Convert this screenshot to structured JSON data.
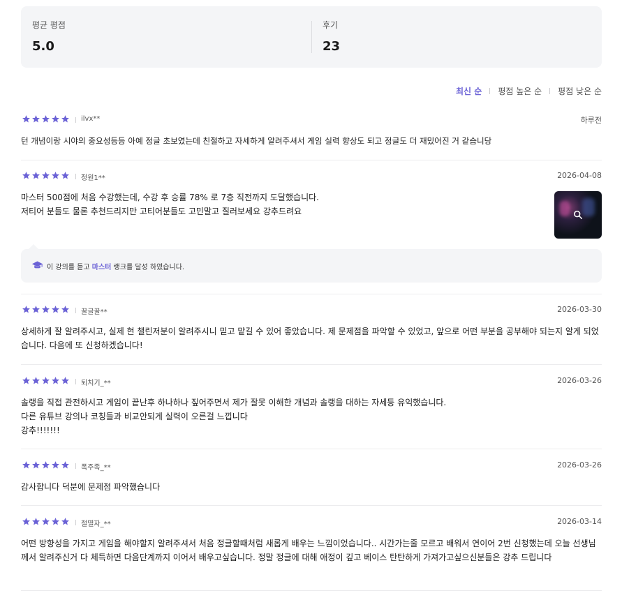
{
  "summary": {
    "avg_label": "평균 평점",
    "avg_value": "5.0",
    "count_label": "후기",
    "count_value": "23"
  },
  "sort": {
    "options": [
      "최신 순",
      "평점 높은 순",
      "평점 낮은 순"
    ],
    "active": "최신 순"
  },
  "accent_color": "#6b62d6",
  "reviews": [
    {
      "rating": 5,
      "author": "ilvx**",
      "date": "하루전",
      "lines": [
        "턴 개념이랑 시야의 중요성등등 아예 정글 초보였는데 친절하고 자세하게 알려주셔서 게임 실력 향상도 되고 정글도 더 재밌어진 거 같습니당"
      ]
    },
    {
      "rating": 5,
      "author": "정원1**",
      "date": "2026-04-08",
      "lines": [
        "마스터 500점에 처음 수강했는데, 수강 후 승률 78% 로 7층 직전까지 도달했습니다.",
        "저티어 분들도 물론 추천드리지만 고티어분들도 고민말고 질러보세요 강추드려요"
      ],
      "has_image": true,
      "achievement": {
        "before": "이 강의를 듣고 ",
        "rank": "마스터",
        "after": " 랭크를 달성 하였습니다."
      }
    },
    {
      "rating": 5,
      "author": "꿀글꿀**",
      "date": "2026-03-30",
      "text": "상세하게 잘 알려주시고, 실제 현 챌린저분이 알려주시니 믿고 맡길 수 있어 좋았습니다. 제 문제점을 파악할 수 있었고, 앞으로 어떤 부분을 공부해야 되는지 알게 되었습니다. 다음에 또 신청하겠습니다!"
    },
    {
      "rating": 5,
      "author": "퇴치기_**",
      "date": "2026-03-26",
      "lines": [
        "솔랭을 직접 관전하시고 게임이 끝난후 하나하나 짚어주면서 제가 잘못 이해한 개념과 솔랭을 대하는 자세등 유익했습니다.",
        "다른 유튜브 강의나 코칭들과 비교안되게 실력이 오른걸 느낍니다",
        "강추!!!!!!!"
      ]
    },
    {
      "rating": 5,
      "author": "폭주족_**",
      "date": "2026-03-26",
      "lines": [
        "감사합니다 덕분에 문제점 파악했습니다"
      ]
    },
    {
      "rating": 5,
      "author": "절멸자_**",
      "date": "2026-03-14",
      "text": "어떤 방향성을 가지고 게임을 해야할지 알려주셔서 처음 정글할때처럼 새롭게 배우는 느낌이었습니다.. 시간가는줄 모르고 배워서 연이어 2번 신청했는데 오늘 선생님께서 알려주신거 다 체득하면 다음단계까지 이어서 배우고싶습니다. 정말 정글에 대해 애정이 깊고 베이스 탄탄하게 가져가고싶으신분들은 강추 드립니다"
    }
  ]
}
